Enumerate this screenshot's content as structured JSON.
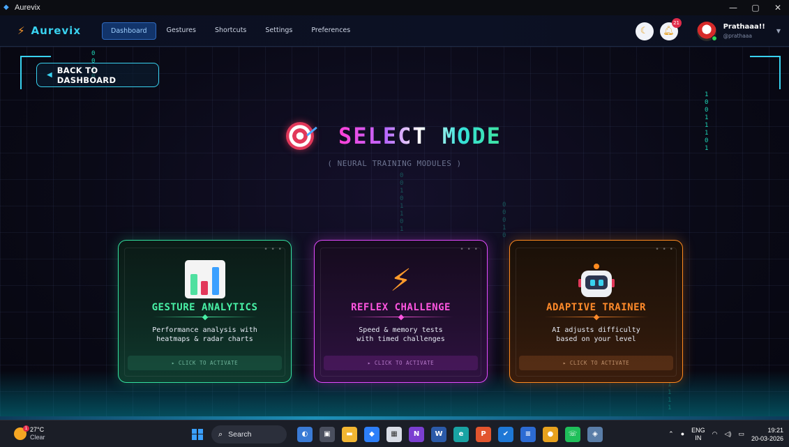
{
  "window": {
    "title": "Aurevix",
    "controls": [
      "—",
      "▢",
      "✕"
    ]
  },
  "nav": {
    "brand": "Aurevix",
    "tabs": [
      {
        "label": "Dashboard",
        "active": true
      },
      {
        "label": "Gestures",
        "active": false
      },
      {
        "label": "Shortcuts",
        "active": false
      },
      {
        "label": "Settings",
        "active": false
      },
      {
        "label": "Preferences",
        "active": false
      }
    ],
    "notification_count": "21",
    "user": {
      "name": "Prathaaa!!",
      "handle": "@prathaaa"
    },
    "theme_icon": "moon-icon"
  },
  "back_button": {
    "label": "BACK TO DASHBOARD"
  },
  "heading": {
    "title": "SELECT MODE",
    "subtitle": "( NEURAL TRAINING MODULES )"
  },
  "cards": [
    {
      "title": "GESTURE ANALYTICS",
      "desc_line1": "Performance analysis with",
      "desc_line2": "heatmaps & radar charts",
      "action": "▸ CLICK TO ACTIVATE",
      "icon": "bar-chart-icon",
      "accent": "#48f0a5"
    },
    {
      "title": "REFLEX CHALLENGE",
      "desc_line1": "Speed & memory tests",
      "desc_line2": "with timed challenges",
      "action": "▸ CLICK TO ACTIVATE",
      "icon": "lightning-icon",
      "accent": "#ff55e0"
    },
    {
      "title": "ADAPTIVE TRAINER",
      "desc_line1": "AI adjusts difficulty",
      "desc_line2": "based on your level",
      "action": "▸ CLICK TO ACTIVATE",
      "icon": "robot-icon",
      "accent": "#ff8a2a"
    }
  ],
  "binary_streams": {
    "left": "0\n0\n1\n0",
    "right": "1\n0\n0\n1\n1\n1\n0\n1",
    "center": "0\n0\n1\n0\n1\n1\n0\n1",
    "center2": "0\n0\n0\n1\n0",
    "bottom_right": "1\n1\n1\n1"
  },
  "taskbar": {
    "weather_temp": "27°C",
    "weather_desc": "Clear",
    "weather_badge": "1",
    "search_label": "Search",
    "language": "ENG",
    "region": "IN",
    "time": "19:21",
    "date": "20-03-2026"
  }
}
